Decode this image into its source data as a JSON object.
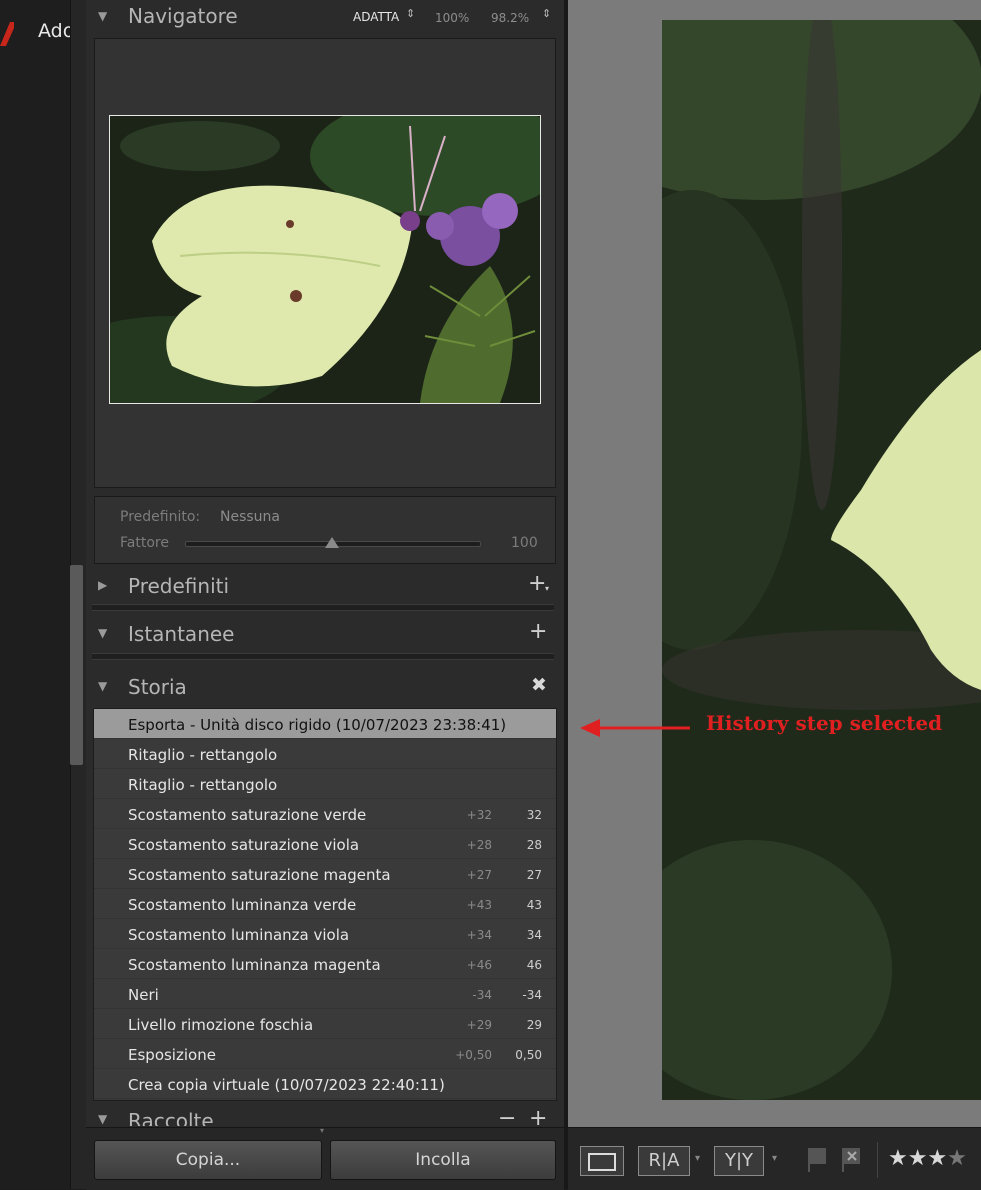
{
  "app": {
    "name": "Ado"
  },
  "navigator": {
    "title": "Navigatore",
    "fit_label": "ADATTA",
    "zoom_1": "100%",
    "zoom_2": "98.2%"
  },
  "preset": {
    "label": "Predefinito:",
    "value": "Nessuna",
    "amount_label": "Fattore",
    "amount_value": "100",
    "slider_level": 0.5
  },
  "panels": {
    "presets": "Predefiniti",
    "snapshots": "Istantanee",
    "history": "Storia",
    "collections": "Raccolte"
  },
  "history": [
    {
      "label": "Esporta - Unità disco rigido (10/07/2023 23:38:41)",
      "d1": "",
      "d2": "",
      "selected": true
    },
    {
      "label": "Ritaglio - rettangolo",
      "d1": "",
      "d2": ""
    },
    {
      "label": "Ritaglio - rettangolo",
      "d1": "",
      "d2": ""
    },
    {
      "label": "Scostamento saturazione verde",
      "d1": "+32",
      "d2": "32"
    },
    {
      "label": "Scostamento saturazione viola",
      "d1": "+28",
      "d2": "28"
    },
    {
      "label": "Scostamento saturazione magenta",
      "d1": "+27",
      "d2": "27"
    },
    {
      "label": "Scostamento luminanza verde",
      "d1": "+43",
      "d2": "43"
    },
    {
      "label": "Scostamento luminanza viola",
      "d1": "+34",
      "d2": "34"
    },
    {
      "label": "Scostamento luminanza magenta",
      "d1": "+46",
      "d2": "46"
    },
    {
      "label": "Neri",
      "d1": "-34",
      "d2": "-34"
    },
    {
      "label": "Livello rimozione foschia",
      "d1": "+29",
      "d2": "29"
    },
    {
      "label": "Esposizione",
      "d1": "+0,50",
      "d2": "0,50"
    },
    {
      "label": "Crea copia virtuale (10/07/2023 22:40:11)",
      "d1": "",
      "d2": ""
    }
  ],
  "buttons": {
    "copy": "Copia...",
    "paste": "Incolla"
  },
  "annotation": {
    "text": "History step selected",
    "color": "#e02020"
  },
  "toolbar": {
    "stars": "★★★★",
    "rating": 3
  }
}
